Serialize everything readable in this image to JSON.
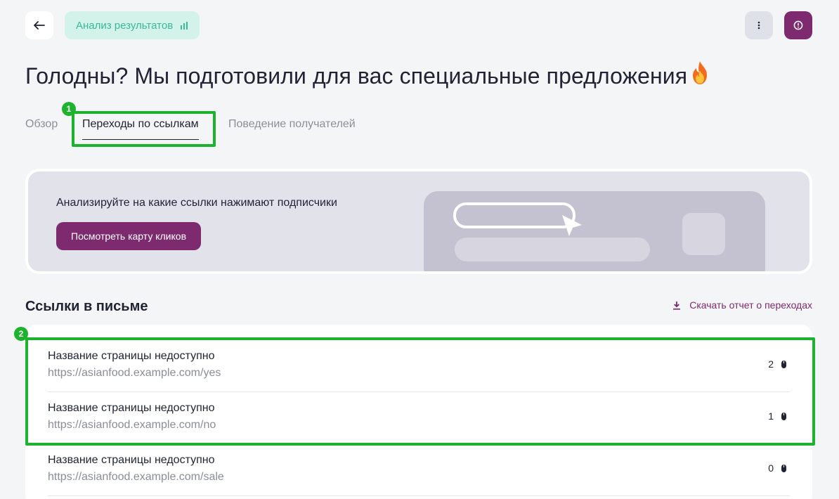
{
  "header": {
    "back_icon": "arrow-left-icon",
    "analysis_label": "Анализ результатов",
    "analysis_icon": "bar-chart-icon",
    "more_icon": "more-vertical-icon",
    "info_icon": "info-circle-icon"
  },
  "title": {
    "text": "Голодны? Мы подготовили для вас специальные предложения",
    "emoji": "🔥"
  },
  "tabs": [
    {
      "label": "Обзор",
      "active": false
    },
    {
      "label": "Переходы по ссылкам",
      "active": true
    },
    {
      "label": "Поведение получателей",
      "active": false
    }
  ],
  "annotations": [
    "1",
    "2"
  ],
  "banner": {
    "text": "Анализируйте на какие ссылки нажимают подписчики",
    "button_label": "Посмотреть карту кликов"
  },
  "links_section": {
    "title": "Ссылки в письме",
    "download_label": "Скачать отчет о переходах",
    "download_icon": "download-icon",
    "rows": [
      {
        "name": "Название страницы недоступно",
        "url": "https://asianfood.example.com/yes",
        "clicks": "2"
      },
      {
        "name": "Название страницы недоступно",
        "url": "https://asianfood.example.com/no",
        "clicks": "1"
      },
      {
        "name": "Название страницы недоступно",
        "url": "https://asianfood.example.com/sale",
        "clicks": "0"
      }
    ],
    "click_icon": "mouse-icon"
  },
  "colors": {
    "accent": "#7d2a6e",
    "chip_bg": "#d3f3ea",
    "chip_text": "#39b89a",
    "highlight": "#1db32e"
  }
}
